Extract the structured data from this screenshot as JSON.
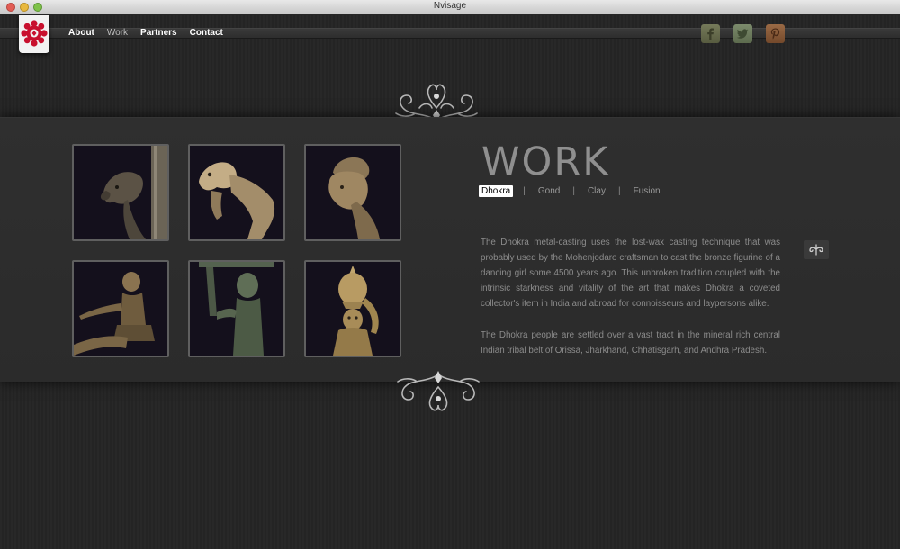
{
  "window": {
    "title": "Nvisage"
  },
  "nav": {
    "items": [
      {
        "label": "About",
        "active": false
      },
      {
        "label": "Work",
        "active": true
      },
      {
        "label": "Partners",
        "active": false
      },
      {
        "label": "Contact",
        "active": false
      }
    ]
  },
  "social": {
    "icons": [
      "facebook-icon",
      "twitter-icon",
      "pinterest-icon"
    ]
  },
  "work": {
    "title": "WORK",
    "tabs": [
      {
        "label": "Dhokra",
        "active": true
      },
      {
        "label": "Gond",
        "active": false
      },
      {
        "label": "Clay",
        "active": false
      },
      {
        "label": "Fusion",
        "active": false
      }
    ],
    "paragraphs": [
      "The Dhokra metal-casting uses the lost-wax casting technique that was probably used by the Mohenjodaro craftsman to cast the bronze figurine of a dancing girl some 4500 years ago. This unbroken tradition coupled with the intrinsic starkness and vitality of the art that makes Dhokra a coveted collector's item in India and abroad for connoisseurs and laypersons alike.",
      "The Dhokra people are settled over a vast tract in the mineral rich central Indian tribal belt of Orissa, Jharkhand, Chhatisgarh, and Andhra Pradesh."
    ]
  },
  "colors": {
    "background": "#252525",
    "panel": "#2e2e2e",
    "title": "#8f8f8f",
    "text": "#8c8c8c",
    "logo_red": "#c8102e"
  }
}
